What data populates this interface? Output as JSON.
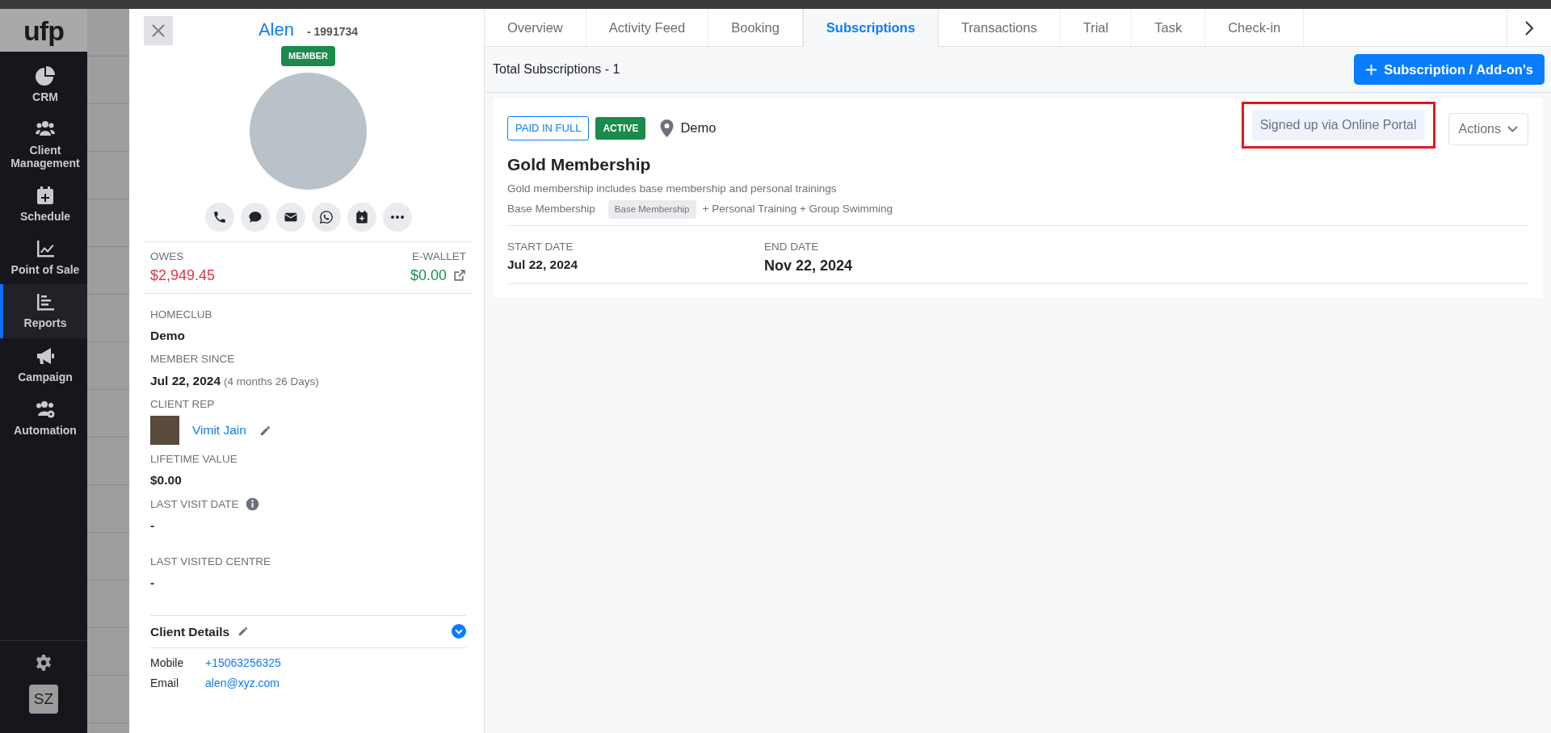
{
  "sidebar": {
    "logo": "ufp",
    "items": [
      {
        "label": "CRM",
        "kind": "pie",
        "selected": false
      },
      {
        "label": "Client Management",
        "kind": "users",
        "selected": false
      },
      {
        "label": "Schedule",
        "kind": "calendar",
        "selected": false
      },
      {
        "label": "Point of Sale",
        "kind": "chart",
        "selected": false
      },
      {
        "label": "Reports",
        "kind": "bars",
        "selected": true
      },
      {
        "label": "Campaign",
        "kind": "megaphone",
        "selected": false
      },
      {
        "label": "Automation",
        "kind": "usersgear",
        "selected": false
      }
    ],
    "user_initials": "SZ"
  },
  "profile": {
    "name": "Alen",
    "client_id": "- 1991734",
    "status_badge": "MEMBER",
    "actions": [
      {
        "kind": "phone"
      },
      {
        "kind": "sms"
      },
      {
        "kind": "email"
      },
      {
        "kind": "whatsapp"
      },
      {
        "kind": "calendar"
      },
      {
        "kind": "more"
      }
    ],
    "owes_label": "OWES",
    "owes": "$2,949.45",
    "wallet_label": "E-WALLET",
    "wallet": "$0.00",
    "fields": [
      {
        "label": "HOMECLUB",
        "value": "Demo"
      },
      {
        "label": "MEMBER SINCE",
        "value": "Jul 22, 2024",
        "note": "(4 months 26 Days)"
      },
      {
        "label": "CLIENT REP",
        "kind": "rep",
        "value": "Vimit Jain"
      },
      {
        "label": "LIFETIME VALUE",
        "value": "$0.00"
      },
      {
        "label": "LAST VISIT DATE",
        "kind": "info",
        "value": "-"
      },
      {
        "label": "LAST VISITED CENTRE",
        "value": "-"
      }
    ],
    "details_title": "Client Details",
    "details": [
      {
        "label": "Mobile",
        "value": "+15063256325"
      },
      {
        "label": "Email",
        "value": "alen@xyz.com"
      }
    ]
  },
  "tabs": [
    {
      "label": "Overview",
      "selected": false
    },
    {
      "label": "Activity Feed",
      "selected": false
    },
    {
      "label": "Booking",
      "selected": false
    },
    {
      "label": "Subscriptions",
      "selected": true
    },
    {
      "label": "Transactions",
      "selected": false
    },
    {
      "label": "Trial",
      "selected": false
    },
    {
      "label": "Task",
      "selected": false
    },
    {
      "label": "Check-in",
      "selected": false
    }
  ],
  "toolbar": {
    "total": "Total Subscriptions - 1",
    "add_button": "Subscription / Add-on's"
  },
  "subscription": {
    "payment_badge": "PAID IN FULL",
    "status_badge": "ACTIVE",
    "location": "Demo",
    "source": "Signed up via Online Portal",
    "source_highlighted": true,
    "actions_button": "Actions",
    "title": "Gold Membership",
    "description": "Gold membership includes base membership and personal trainings",
    "base_label": "Base Membership",
    "base_tag": "Base Membership",
    "addons": "+ Personal Training + Group Swimming",
    "start_label": "START DATE",
    "start": "Jul 22, 2024",
    "end_label": "END DATE",
    "end": "Nov 22, 2024"
  }
}
